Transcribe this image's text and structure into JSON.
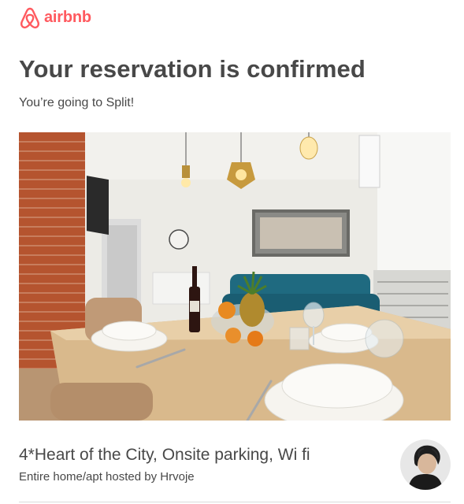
{
  "brand": {
    "name": "airbnb",
    "color": "#ff5a5f",
    "logo_icon": "airbnb-belo-icon"
  },
  "confirmation": {
    "title": "Your reservation is confirmed",
    "subtitle": "You’re going to Split!"
  },
  "listing": {
    "photo_subject": "listing-interior-photo",
    "title": "4*Heart of the City, Onsite parking, Wi fi",
    "subtitle": "Entire home/apt hosted by Hrvoje",
    "host_avatar": "host-avatar-photo"
  },
  "colors": {
    "text": "#484848",
    "divider": "#dbdbdb"
  }
}
